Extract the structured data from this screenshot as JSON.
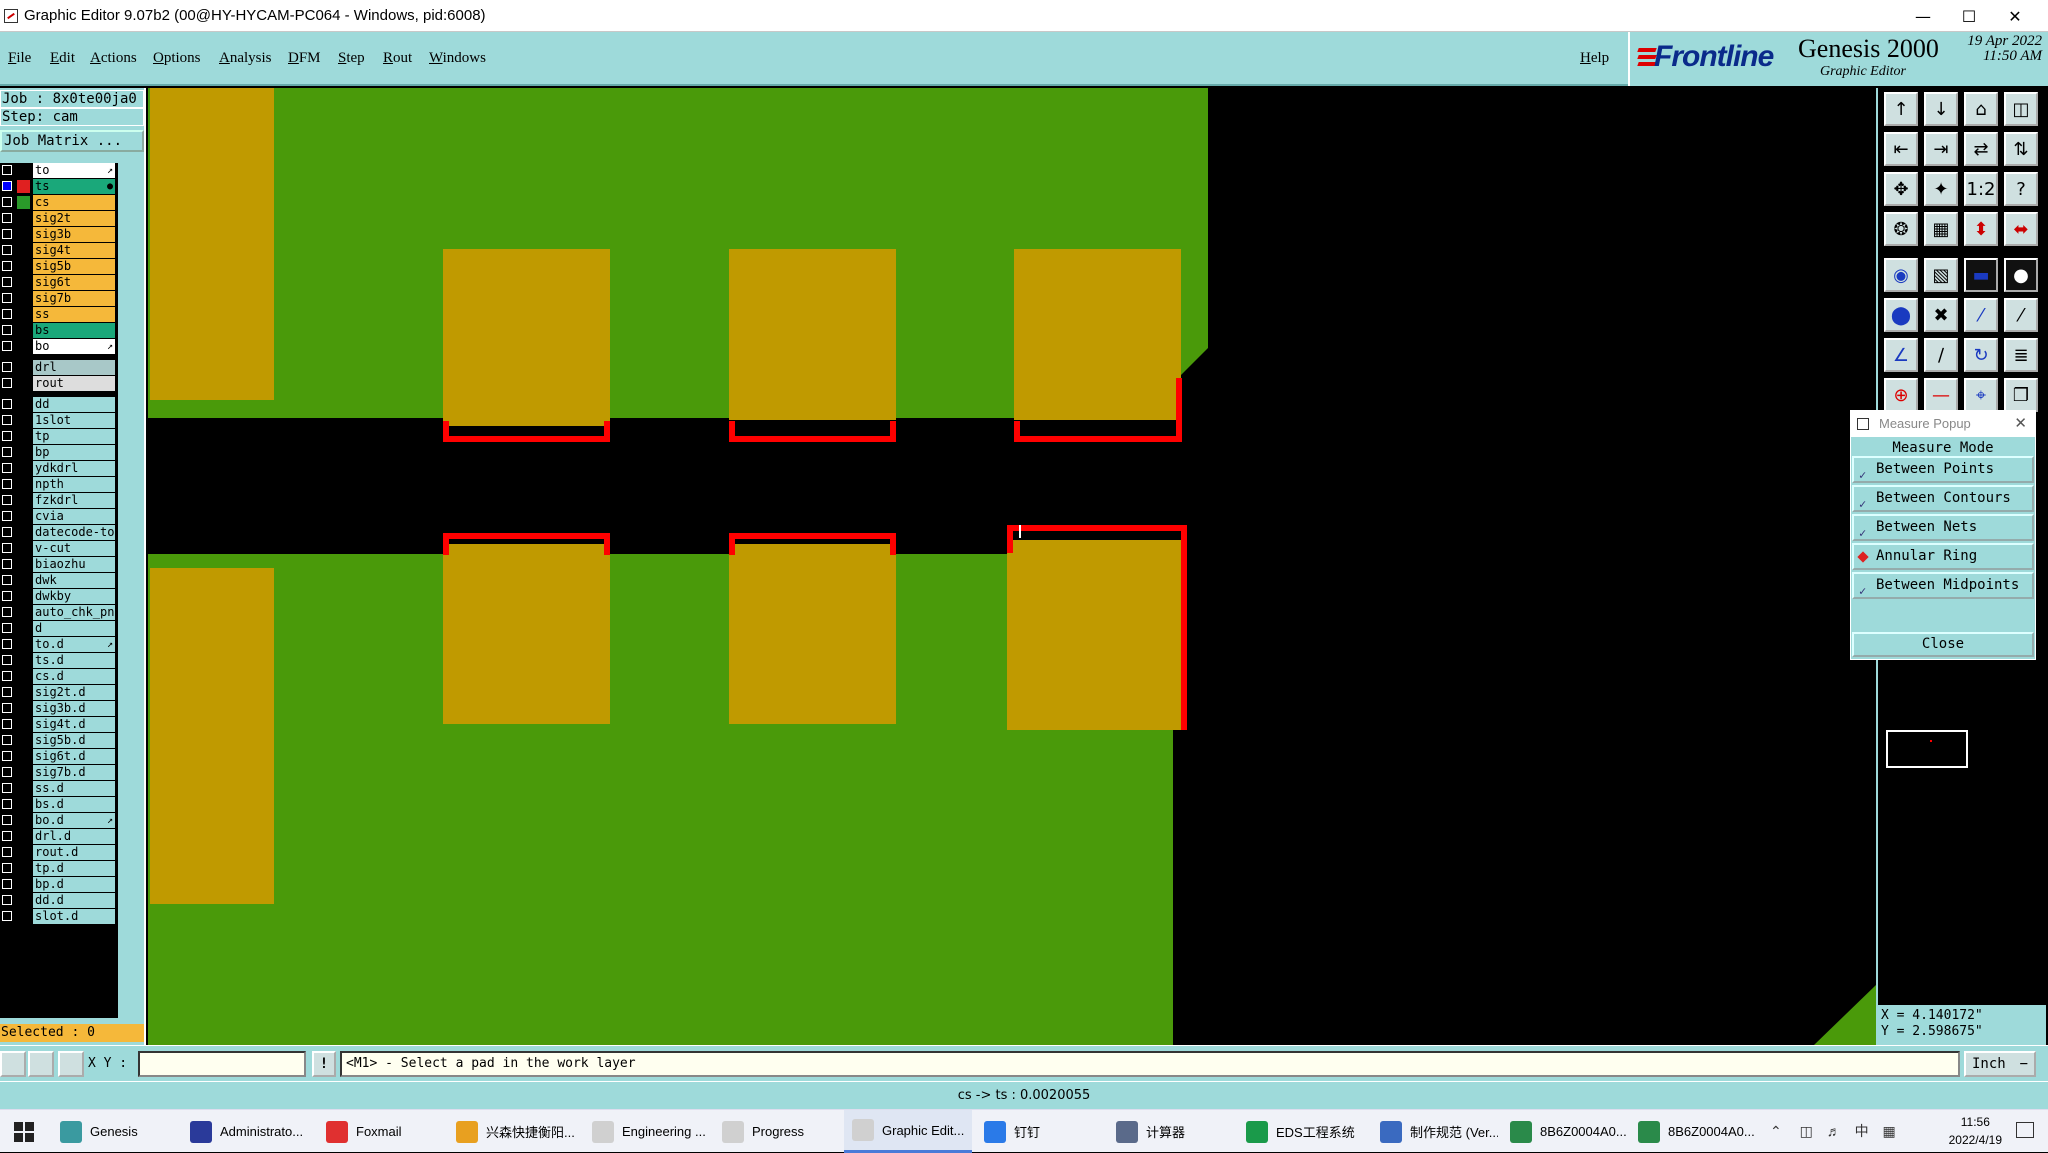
{
  "window": {
    "title": "Graphic Editor 9.07b2 (00@HY-HYCAM-PC064 - Windows, pid:6008)"
  },
  "menu": [
    "File",
    "Edit",
    "Actions",
    "Options",
    "Analysis",
    "DFM",
    "Step",
    "Rout",
    "Windows"
  ],
  "help": "Help",
  "brand": {
    "logo": "Frontline",
    "product": "Genesis 2000",
    "subtitle": "Graphic Editor",
    "date": "19 Apr 2022",
    "time": "11:50 AM"
  },
  "job": {
    "job": "Job : 8x0te00ja0",
    "step": "Step: cam",
    "matrix_button": "Job Matrix ..."
  },
  "layers": [
    {
      "name": "to",
      "color": "#ffffff",
      "mark": "↗",
      "checked": false,
      "sw": "#000000"
    },
    {
      "name": "ts",
      "color": "#1aa87a",
      "mark": "●",
      "checked": true,
      "sw": "#e02020"
    },
    {
      "name": "cs",
      "color": "#f5b83a",
      "mark": "",
      "checked": false,
      "sw": "#2a9a2a"
    },
    {
      "name": "sig2t",
      "color": "#f5b83a",
      "mark": "",
      "checked": false,
      "sw": "#000000"
    },
    {
      "name": "sig3b",
      "color": "#f5b83a",
      "mark": "",
      "checked": false,
      "sw": "#000000"
    },
    {
      "name": "sig4t",
      "color": "#f5b83a",
      "mark": "",
      "checked": false,
      "sw": "#000000"
    },
    {
      "name": "sig5b",
      "color": "#f5b83a",
      "mark": "",
      "checked": false,
      "sw": "#000000"
    },
    {
      "name": "sig6t",
      "color": "#f5b83a",
      "mark": "",
      "checked": false,
      "sw": "#000000"
    },
    {
      "name": "sig7b",
      "color": "#f5b83a",
      "mark": "",
      "checked": false,
      "sw": "#000000"
    },
    {
      "name": "ss",
      "color": "#f5b83a",
      "mark": "",
      "checked": false,
      "sw": "#000000"
    },
    {
      "name": "bs",
      "color": "#1aa87a",
      "mark": "",
      "checked": false,
      "sw": "#000000"
    },
    {
      "name": "bo",
      "color": "#ffffff",
      "mark": "↗",
      "checked": false,
      "sw": "#000000"
    },
    {
      "name": "drl",
      "color": "#a8c8c8",
      "mark": "",
      "checked": false,
      "sw": "#000000",
      "gap": true
    },
    {
      "name": "rout",
      "color": "#dddddd",
      "mark": "",
      "checked": false,
      "sw": "#000000"
    },
    {
      "name": "dd",
      "color": "#9edada",
      "mark": "",
      "checked": false,
      "sw": "#000000",
      "gap": true
    },
    {
      "name": "1slot",
      "color": "#9edada",
      "mark": "",
      "checked": false,
      "sw": "#000000"
    },
    {
      "name": "tp",
      "color": "#9edada",
      "mark": "",
      "checked": false,
      "sw": "#000000"
    },
    {
      "name": "bp",
      "color": "#9edada",
      "mark": "",
      "checked": false,
      "sw": "#000000"
    },
    {
      "name": "ydkdrl",
      "color": "#9edada",
      "mark": "",
      "checked": false,
      "sw": "#000000"
    },
    {
      "name": "npth",
      "color": "#9edada",
      "mark": "",
      "checked": false,
      "sw": "#000000"
    },
    {
      "name": "fzkdrl",
      "color": "#9edada",
      "mark": "",
      "checked": false,
      "sw": "#000000"
    },
    {
      "name": "cvia",
      "color": "#9edada",
      "mark": "",
      "checked": false,
      "sw": "#000000"
    },
    {
      "name": "datecode-to",
      "color": "#9edada",
      "mark": "",
      "checked": false,
      "sw": "#000000"
    },
    {
      "name": "v-cut",
      "color": "#9edada",
      "mark": "",
      "checked": false,
      "sw": "#000000"
    },
    {
      "name": "biaozhu",
      "color": "#9edada",
      "mark": "",
      "checked": false,
      "sw": "#000000"
    },
    {
      "name": "dwk",
      "color": "#9edada",
      "mark": "",
      "checked": false,
      "sw": "#000000"
    },
    {
      "name": "dwkby",
      "color": "#9edada",
      "mark": "",
      "checked": false,
      "sw": "#000000"
    },
    {
      "name": "auto_chk_pn",
      "color": "#9edada",
      "mark": "",
      "checked": false,
      "sw": "#000000"
    },
    {
      "name": "d",
      "color": "#9edada",
      "mark": "",
      "checked": false,
      "sw": "#000000"
    },
    {
      "name": "to.d",
      "color": "#9edada",
      "mark": "↗",
      "checked": false,
      "sw": "#000000"
    },
    {
      "name": "ts.d",
      "color": "#9edada",
      "mark": "",
      "checked": false,
      "sw": "#000000"
    },
    {
      "name": "cs.d",
      "color": "#9edada",
      "mark": "",
      "checked": false,
      "sw": "#000000"
    },
    {
      "name": "sig2t.d",
      "color": "#9edada",
      "mark": "",
      "checked": false,
      "sw": "#000000"
    },
    {
      "name": "sig3b.d",
      "color": "#9edada",
      "mark": "",
      "checked": false,
      "sw": "#000000"
    },
    {
      "name": "sig4t.d",
      "color": "#9edada",
      "mark": "",
      "checked": false,
      "sw": "#000000"
    },
    {
      "name": "sig5b.d",
      "color": "#9edada",
      "mark": "",
      "checked": false,
      "sw": "#000000"
    },
    {
      "name": "sig6t.d",
      "color": "#9edada",
      "mark": "",
      "checked": false,
      "sw": "#000000"
    },
    {
      "name": "sig7b.d",
      "color": "#9edada",
      "mark": "",
      "checked": false,
      "sw": "#000000"
    },
    {
      "name": "ss.d",
      "color": "#9edada",
      "mark": "",
      "checked": false,
      "sw": "#000000"
    },
    {
      "name": "bs.d",
      "color": "#9edada",
      "mark": "",
      "checked": false,
      "sw": "#000000"
    },
    {
      "name": "bo.d",
      "color": "#9edada",
      "mark": "↗",
      "checked": false,
      "sw": "#000000"
    },
    {
      "name": "drl.d",
      "color": "#9edada",
      "mark": "",
      "checked": false,
      "sw": "#000000"
    },
    {
      "name": "rout.d",
      "color": "#9edada",
      "mark": "",
      "checked": false,
      "sw": "#000000"
    },
    {
      "name": "tp.d",
      "color": "#9edada",
      "mark": "",
      "checked": false,
      "sw": "#000000"
    },
    {
      "name": "bp.d",
      "color": "#9edada",
      "mark": "",
      "checked": false,
      "sw": "#000000"
    },
    {
      "name": "dd.d",
      "color": "#9edada",
      "mark": "",
      "checked": false,
      "sw": "#000000"
    },
    {
      "name": "slot.d",
      "color": "#9edada",
      "mark": "",
      "checked": false,
      "sw": "#000000"
    }
  ],
  "selected": "Selected : 0",
  "measure": {
    "header": "Measure Popup",
    "title": "Measure Mode",
    "modes": [
      {
        "label": "Between Points",
        "active": false
      },
      {
        "label": "Between Contours",
        "active": false
      },
      {
        "label": "Between Nets",
        "active": false
      },
      {
        "label": "Annular Ring",
        "active": true
      },
      {
        "label": "Between Midpoints",
        "active": false
      }
    ],
    "close": "Close"
  },
  "coords": {
    "x": "X = 4.140172\"",
    "y": "Y = 2.598675\""
  },
  "status": {
    "xy_label": "X Y :",
    "xy_value": "",
    "info": "!",
    "prompt": "<M1> - Select a pad in the work layer",
    "units": "Inch"
  },
  "message": "cs -> ts : 0.0020055",
  "taskbar": {
    "items": [
      {
        "label": "Genesis",
        "color": "#3a9aa0"
      },
      {
        "label": "Administrato...",
        "color": "#2a3a9a"
      },
      {
        "label": "Foxmail",
        "color": "#e03030"
      },
      {
        "label": "兴森快捷衡阳...",
        "color": "#e8a020"
      },
      {
        "label": "Engineering ...",
        "color": "#d0d0d0"
      },
      {
        "label": "Progress",
        "color": "#d0d0d0"
      },
      {
        "label": "Graphic Edit...",
        "color": "#d0d0d0"
      },
      {
        "label": "钉钉",
        "color": "#2a7ae8"
      },
      {
        "label": "计算器",
        "color": "#5a6a8a"
      },
      {
        "label": "EDS工程系统",
        "color": "#1a9a4a"
      },
      {
        "label": "制作规范 (Ver...",
        "color": "#3a6ac0"
      },
      {
        "label": "8B6Z0004A0...",
        "color": "#2a8a4a"
      },
      {
        "label": "8B6Z0004A0...",
        "color": "#2a8a4a"
      }
    ],
    "active_index": 6,
    "time": "11:56",
    "date": "2022/4/19",
    "ime": "中"
  },
  "colors": {
    "board": "#4a9a0a",
    "pad": "#c09a00",
    "highlight": "#ff0000",
    "panel": "#9edada"
  }
}
